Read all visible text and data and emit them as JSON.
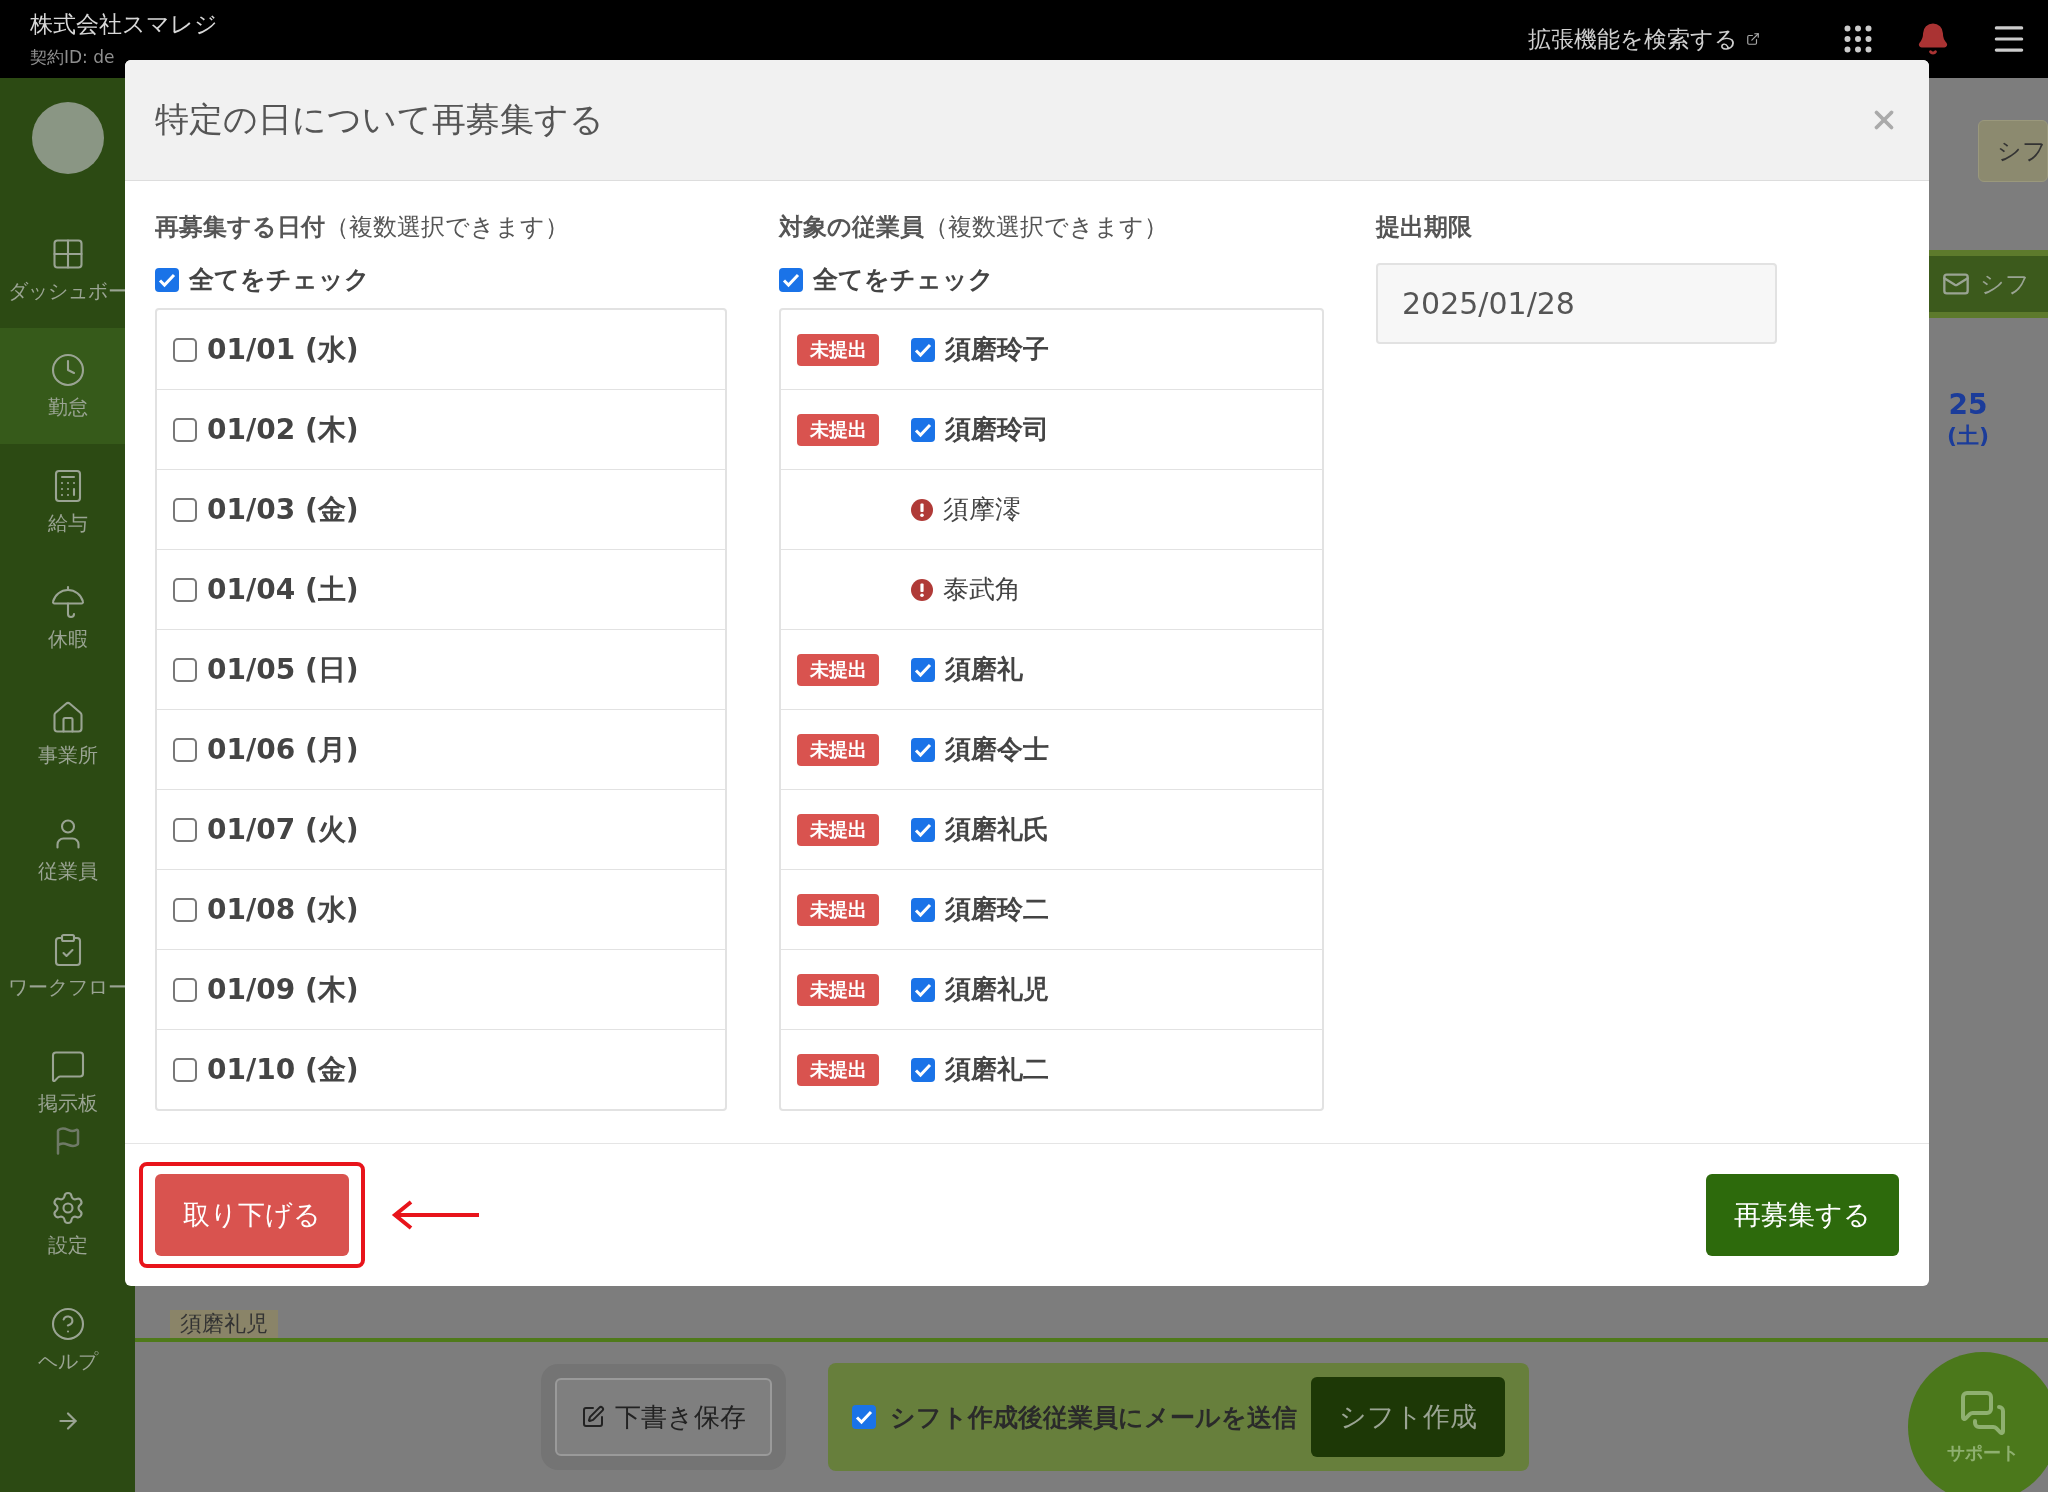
{
  "topbar": {
    "company": "株式会社スマレジ",
    "contract": "契約ID: de",
    "extension_link": "拡張機能を検索する"
  },
  "sidebar": {
    "items": [
      {
        "label": "ダッシュボー",
        "selected": false
      },
      {
        "label": "勤怠",
        "selected": true
      },
      {
        "label": "給与",
        "selected": false
      },
      {
        "label": "休暇",
        "selected": false
      },
      {
        "label": "事業所",
        "selected": false
      },
      {
        "label": "従業員",
        "selected": false
      },
      {
        "label": "ワークフロー",
        "selected": false
      },
      {
        "label": "掲示板",
        "selected": false
      },
      {
        "label": "設定",
        "selected": false
      },
      {
        "label": "ヘルプ",
        "selected": false
      }
    ]
  },
  "background": {
    "top_button": "シフ",
    "mail_button": "シフ",
    "calendar_day": "25",
    "calendar_weekday": "(土)",
    "row_name": "須磨礼児"
  },
  "modal": {
    "title": "特定の日について再募集する",
    "dates": {
      "heading": "再募集する日付",
      "note": "（複数選択できます）",
      "check_all": {
        "label": "全てをチェック",
        "checked": true
      },
      "items": [
        {
          "label": "01/01 (水)",
          "checked": false
        },
        {
          "label": "01/02 (木)",
          "checked": false
        },
        {
          "label": "01/03 (金)",
          "checked": false
        },
        {
          "label": "01/04 (土)",
          "checked": false
        },
        {
          "label": "01/05 (日)",
          "checked": false
        },
        {
          "label": "01/06 (月)",
          "checked": false
        },
        {
          "label": "01/07 (火)",
          "checked": false
        },
        {
          "label": "01/08 (水)",
          "checked": false
        },
        {
          "label": "01/09 (木)",
          "checked": false
        },
        {
          "label": "01/10 (金)",
          "checked": false
        }
      ]
    },
    "employees": {
      "heading": "対象の従業員",
      "note": "（複数選択できます）",
      "check_all": {
        "label": "全てをチェック",
        "checked": true
      },
      "items": [
        {
          "kind": "pending",
          "badge": "未提出",
          "name": "須磨玲子",
          "checked": true
        },
        {
          "kind": "pending",
          "badge": "未提出",
          "name": "須磨玲司",
          "checked": true
        },
        {
          "kind": "warning",
          "name": "須摩澪"
        },
        {
          "kind": "warning",
          "name": "泰武角"
        },
        {
          "kind": "pending",
          "badge": "未提出",
          "name": "須磨礼",
          "checked": true
        },
        {
          "kind": "pending",
          "badge": "未提出",
          "name": "須磨令士",
          "checked": true
        },
        {
          "kind": "pending",
          "badge": "未提出",
          "name": "須磨礼氏",
          "checked": true
        },
        {
          "kind": "pending",
          "badge": "未提出",
          "name": "須磨玲二",
          "checked": true
        },
        {
          "kind": "pending",
          "badge": "未提出",
          "name": "須磨礼児",
          "checked": true
        },
        {
          "kind": "pending",
          "badge": "未提出",
          "name": "須磨礼二",
          "checked": true
        }
      ]
    },
    "deadline": {
      "label": "提出期限",
      "value": "2025/01/28"
    },
    "withdraw_button": "取り下げる",
    "submit_button": "再募集する"
  },
  "bottom_bar": {
    "draft_button": "下書き保存",
    "mail_option": {
      "label": "シフト作成後従業員にメールを送信",
      "checked": true
    },
    "create_button": "シフト作成",
    "support": "サポート"
  }
}
